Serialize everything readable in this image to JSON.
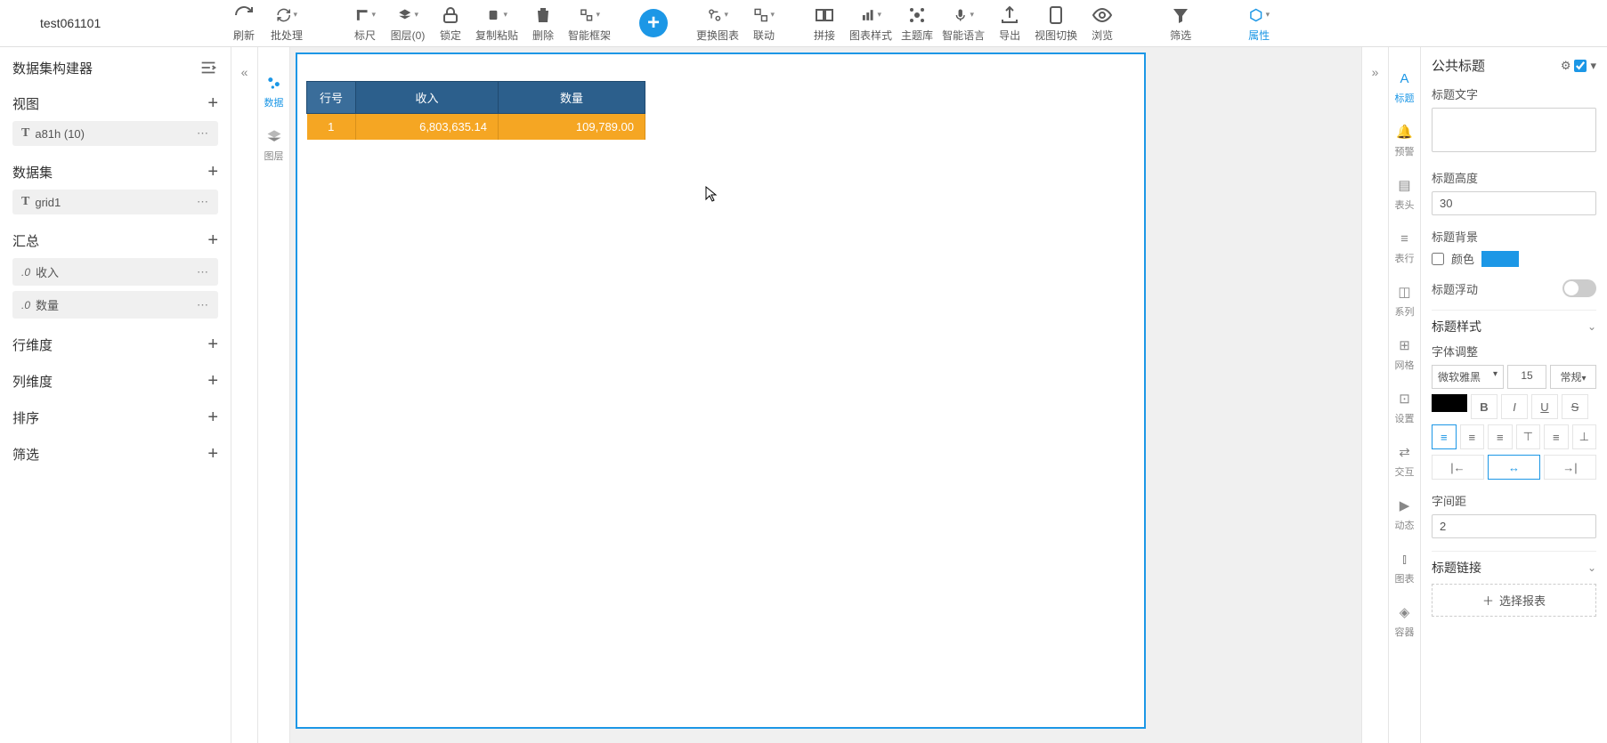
{
  "title": "test061101",
  "toolbar": [
    {
      "id": "refresh",
      "label": "刷新"
    },
    {
      "id": "batch",
      "label": "批处理",
      "drop": true
    },
    {
      "id": "sp",
      "spacer": "md"
    },
    {
      "id": "ruler",
      "label": "标尺",
      "drop": true
    },
    {
      "id": "layer",
      "label": "图层(0)",
      "drop": true
    },
    {
      "id": "lock",
      "label": "锁定"
    },
    {
      "id": "copypaste",
      "label": "复制粘贴",
      "drop": true
    },
    {
      "id": "delete",
      "label": "删除"
    },
    {
      "id": "smartframe",
      "label": "智能框架",
      "drop": true
    },
    {
      "id": "sp2",
      "spacer": "sm"
    },
    {
      "id": "add",
      "label": "",
      "add": true
    },
    {
      "id": "sp3",
      "spacer": "sm"
    },
    {
      "id": "swapchart",
      "label": "更换图表",
      "drop": true
    },
    {
      "id": "link",
      "label": "联动",
      "drop": true
    },
    {
      "id": "sp4",
      "spacer": "sm"
    },
    {
      "id": "merge",
      "label": "拼接"
    },
    {
      "id": "chartstyle",
      "label": "图表样式",
      "drop": true
    },
    {
      "id": "themelib",
      "label": "主题库"
    },
    {
      "id": "smartlang",
      "label": "智能语言",
      "drop": true
    },
    {
      "id": "export",
      "label": "导出"
    },
    {
      "id": "viewswitch",
      "label": "视图切换"
    },
    {
      "id": "preview",
      "label": "浏览"
    },
    {
      "id": "sp5",
      "spacer": "md"
    },
    {
      "id": "filter",
      "label": "筛选"
    },
    {
      "id": "sp6",
      "spacer": "md"
    },
    {
      "id": "props",
      "label": "属性",
      "active": true,
      "drop": true
    }
  ],
  "left": {
    "title": "数据集构建器",
    "sections": [
      {
        "title": "视图",
        "items": [
          {
            "icon": "T",
            "label": "a81h (10)"
          }
        ]
      },
      {
        "title": "数据集",
        "items": [
          {
            "icon": "T",
            "label": "grid1"
          }
        ]
      },
      {
        "title": "汇总",
        "items": [
          {
            "icon": ".0",
            "label": "收入"
          },
          {
            "icon": ".0",
            "label": "数量"
          }
        ]
      },
      {
        "title": "行维度",
        "items": []
      },
      {
        "title": "列维度",
        "items": []
      },
      {
        "title": "排序",
        "items": []
      },
      {
        "title": "筛选",
        "items": []
      }
    ]
  },
  "vtabs_left": [
    {
      "id": "data",
      "label": "数据",
      "active": true
    },
    {
      "id": "layers",
      "label": "图层"
    }
  ],
  "table": {
    "headers": [
      "行号",
      "收入",
      "数量"
    ],
    "rows": [
      [
        "1",
        "6,803,635.14",
        "109,789.00"
      ]
    ]
  },
  "vtabs_right": [
    {
      "id": "title",
      "label": "标题",
      "active": true
    },
    {
      "id": "alert",
      "label": "预警"
    },
    {
      "id": "thead",
      "label": "表头"
    },
    {
      "id": "trow",
      "label": "表行"
    },
    {
      "id": "series",
      "label": "系列"
    },
    {
      "id": "grid",
      "label": "网格"
    },
    {
      "id": "settings",
      "label": "设置"
    },
    {
      "id": "interact",
      "label": "交互"
    },
    {
      "id": "dynamic",
      "label": "动态"
    },
    {
      "id": "pivot",
      "label": "图表"
    },
    {
      "id": "container",
      "label": "容器"
    }
  ],
  "right": {
    "panel_title": "公共标题",
    "l_title_text": "标题文字",
    "v_title_text": "",
    "l_title_height": "标题高度",
    "v_title_height": "30",
    "l_title_bg": "标题背景",
    "l_color": "颜色",
    "l_title_float": "标题浮动",
    "l_title_style": "标题样式",
    "l_font_adjust": "字体调整",
    "v_font": "微软雅黑",
    "v_size": "15",
    "v_weight": "常规",
    "l_letter_spacing": "字间距",
    "v_letter_spacing": "2",
    "l_title_link": "标题链接",
    "btn_select_report": "选择报表"
  }
}
